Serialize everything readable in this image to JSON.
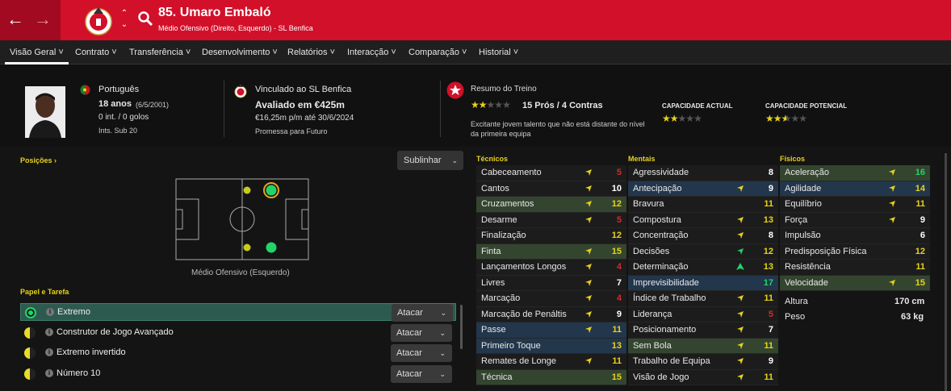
{
  "header": {
    "player_title": "85. Umaro Embaló",
    "subtitle": "Médio Ofensivo (Direito, Esquerdo) - SL Benfica",
    "colors": {
      "bar": "#d2102a",
      "bar_dark": "#a10a20"
    }
  },
  "tabs": [
    "Visão Geral",
    "Contrato",
    "Transferência",
    "Desenvolvimento",
    "Relatórios",
    "Interacção",
    "Comparação",
    "Historial"
  ],
  "info": {
    "nationality": "Português",
    "age": "18 anos",
    "dob": "(6/5/2001)",
    "caps": "0 int. / 0 golos",
    "youth": "Ints. Sub 20",
    "contract_club": "Vinculado ao SL Benfica",
    "value": "Avaliado em €425m",
    "wage": "€16,25m p/m até 30/6/2024",
    "status": "Promessa para Futuro",
    "training_title": "Resumo do Treino",
    "training_stars": 2,
    "training_summary": "15 Prós / 4 Contras",
    "training_text": "Excitante jovem talento que não está distante do nível da primeira equipa",
    "ca_label": "CAPACIDADE ACTUAL",
    "pa_label": "CAPACIDADE POTENCIAL",
    "ca_stars": 2,
    "pa_stars": 2.5
  },
  "positions": {
    "title": "Posições",
    "highlight_label": "Sublinhar",
    "role_label": "Médio Ofensivo (Esquerdo)"
  },
  "roles": {
    "title": "Papel e Tarefa",
    "items": [
      {
        "name": "Extremo",
        "duty": "Atacar",
        "selected": true,
        "dot": "#22d36a"
      },
      {
        "name": "Construtor de Jogo Avançado",
        "duty": "Atacar",
        "selected": false,
        "dot": "#e8dc2a"
      },
      {
        "name": "Extremo invertido",
        "duty": "Atacar",
        "selected": false,
        "dot": "#e8dc2a"
      },
      {
        "name": "Número 10",
        "duty": "Atacar",
        "selected": false,
        "dot": "#e8dc2a"
      }
    ]
  },
  "attributes": {
    "technical": {
      "title": "Técnicos",
      "rows": [
        {
          "name": "Cabeceamento",
          "value": "5",
          "arrow": "yellow",
          "hl": "",
          "color": "#d42a2a"
        },
        {
          "name": "Cantos",
          "value": "10",
          "arrow": "yellow",
          "hl": "",
          "color": "#ffffff"
        },
        {
          "name": "Cruzamentos",
          "value": "12",
          "arrow": "yellow",
          "hl": "g",
          "color": "#e7d21b"
        },
        {
          "name": "Desarme",
          "value": "5",
          "arrow": "yellow",
          "hl": "",
          "color": "#d42a2a"
        },
        {
          "name": "Finalização",
          "value": "12",
          "arrow": "",
          "hl": "",
          "color": "#e7d21b"
        },
        {
          "name": "Finta",
          "value": "15",
          "arrow": "yellow",
          "hl": "g",
          "color": "#e7d21b"
        },
        {
          "name": "Lançamentos Longos",
          "value": "4",
          "arrow": "yellow",
          "hl": "",
          "color": "#d42a2a"
        },
        {
          "name": "Livres",
          "value": "7",
          "arrow": "yellow",
          "hl": "",
          "color": "#ffffff"
        },
        {
          "name": "Marcação",
          "value": "4",
          "arrow": "yellow",
          "hl": "",
          "color": "#d42a2a"
        },
        {
          "name": "Marcação de Penáltis",
          "value": "9",
          "arrow": "yellow",
          "hl": "",
          "color": "#ffffff"
        },
        {
          "name": "Passe",
          "value": "11",
          "arrow": "yellow",
          "hl": "b",
          "color": "#e7d21b"
        },
        {
          "name": "Primeiro Toque",
          "value": "13",
          "arrow": "",
          "hl": "b",
          "color": "#e7d21b"
        },
        {
          "name": "Remates de Longe",
          "value": "11",
          "arrow": "yellow",
          "hl": "",
          "color": "#e7d21b"
        },
        {
          "name": "Técnica",
          "value": "15",
          "arrow": "",
          "hl": "g",
          "color": "#e7d21b"
        }
      ]
    },
    "mental": {
      "title": "Mentais",
      "rows": [
        {
          "name": "Agressividade",
          "value": "8",
          "arrow": "",
          "hl": "",
          "color": "#ffffff"
        },
        {
          "name": "Antecipação",
          "value": "9",
          "arrow": "yellow",
          "hl": "b",
          "color": "#ffffff"
        },
        {
          "name": "Bravura",
          "value": "11",
          "arrow": "",
          "hl": "",
          "color": "#e7d21b"
        },
        {
          "name": "Compostura",
          "value": "13",
          "arrow": "yellow",
          "hl": "",
          "color": "#e7d21b"
        },
        {
          "name": "Concentração",
          "value": "8",
          "arrow": "yellow",
          "hl": "",
          "color": "#ffffff"
        },
        {
          "name": "Decisões",
          "value": "12",
          "arrow": "green",
          "hl": "",
          "color": "#e7d21b"
        },
        {
          "name": "Determinação",
          "value": "13",
          "arrow": "green-up",
          "hl": "",
          "color": "#e7d21b"
        },
        {
          "name": "Imprevisibilidade",
          "value": "17",
          "arrow": "",
          "hl": "b",
          "color": "#22d36a"
        },
        {
          "name": "Índice de Trabalho",
          "value": "11",
          "arrow": "yellow",
          "hl": "",
          "color": "#e7d21b"
        },
        {
          "name": "Liderança",
          "value": "5",
          "arrow": "yellow",
          "hl": "",
          "color": "#d42a2a"
        },
        {
          "name": "Posicionamento",
          "value": "7",
          "arrow": "yellow",
          "hl": "",
          "color": "#ffffff"
        },
        {
          "name": "Sem Bola",
          "value": "11",
          "arrow": "yellow",
          "hl": "g",
          "color": "#e7d21b"
        },
        {
          "name": "Trabalho de Equipa",
          "value": "9",
          "arrow": "yellow",
          "hl": "",
          "color": "#ffffff"
        },
        {
          "name": "Visão de Jogo",
          "value": "11",
          "arrow": "yellow",
          "hl": "",
          "color": "#e7d21b"
        }
      ]
    },
    "physical": {
      "title": "Físicos",
      "rows": [
        {
          "name": "Aceleração",
          "value": "16",
          "arrow": "yellow",
          "hl": "g",
          "color": "#22d36a"
        },
        {
          "name": "Agilidade",
          "value": "14",
          "arrow": "yellow",
          "hl": "b",
          "color": "#e7d21b"
        },
        {
          "name": "Equilíbrio",
          "value": "11",
          "arrow": "yellow",
          "hl": "",
          "color": "#e7d21b"
        },
        {
          "name": "Força",
          "value": "9",
          "arrow": "yellow",
          "hl": "",
          "color": "#ffffff"
        },
        {
          "name": "Impulsão",
          "value": "6",
          "arrow": "",
          "hl": "",
          "color": "#ffffff"
        },
        {
          "name": "Predisposição Física",
          "value": "12",
          "arrow": "",
          "hl": "",
          "color": "#e7d21b"
        },
        {
          "name": "Resistência",
          "value": "11",
          "arrow": "",
          "hl": "",
          "color": "#e7d21b"
        },
        {
          "name": "Velocidade",
          "value": "15",
          "arrow": "yellow",
          "hl": "g",
          "color": "#e7d21b"
        }
      ],
      "height_label": "Altura",
      "height": "170 cm",
      "weight_label": "Peso",
      "weight": "63 kg"
    }
  }
}
